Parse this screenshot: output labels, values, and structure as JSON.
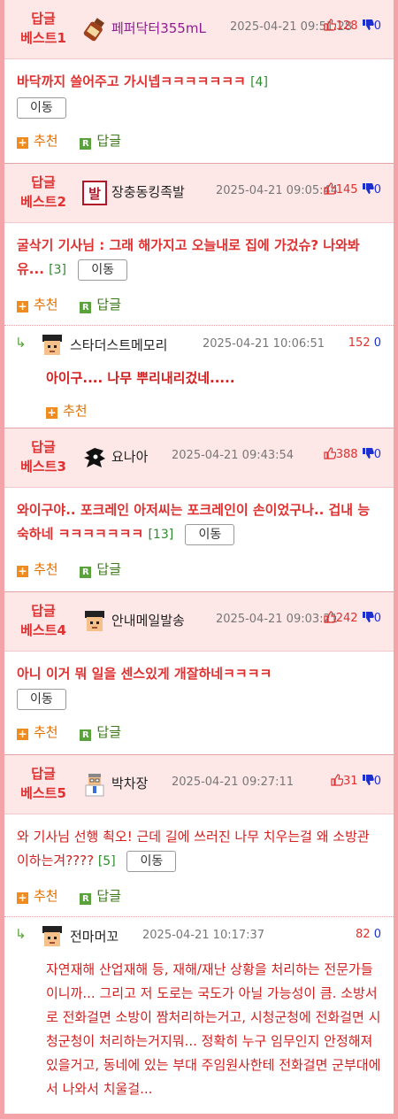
{
  "colors": {
    "accent": "#e03131",
    "frame": "#f4a3a8",
    "header_bg": "#fde7e7",
    "down": "#1e2fd0",
    "count": "#2d8a2d"
  },
  "labels": {
    "move": "이동",
    "recommend": "추천",
    "reply": "답글",
    "reply_badge": "R",
    "recommend_badge": "+"
  },
  "posts": [
    {
      "rank_line1": "답글",
      "rank_line2": "베스트1",
      "nick": "페퍼닥터355mL",
      "date": "2025-04-21 09:51:28",
      "up": "128",
      "down": "0",
      "text": "바닥까지 쓸어주고 가시넵ㅋㅋㅋㅋㅋㅋㅋ",
      "count": "[4]"
    },
    {
      "rank_line1": "답글",
      "rank_line2": "베스트2",
      "nick": "장충동킹족발",
      "date": "2025-04-21 09:05:44",
      "up": "145",
      "down": "0",
      "text": "굴삭기 기사님 : 그래 해가지고 오늘내로 집에 가겄슈? 나와봐유...",
      "count": "[3]"
    },
    {
      "rank_line1": "답글",
      "rank_line2": "베스트3",
      "nick": "요나아",
      "date": "2025-04-21 09:43:54",
      "up": "388",
      "down": "0",
      "text": "와이구야.. 포크레인 아저씨는 포크레인이 손이었구나.. 겁내 능숙하네 ㅋㅋㅋㅋㅋㅋㅋ",
      "count": "[13]"
    },
    {
      "rank_line1": "답글",
      "rank_line2": "베스트4",
      "nick": "안내메일발송",
      "date": "2025-04-21 09:03:21",
      "up": "242",
      "down": "0",
      "text": "아니 이거 뭐 일을 센스있게 개잘하네ㅋㅋㅋㅋ",
      "count": ""
    },
    {
      "rank_line1": "답글",
      "rank_line2": "베스트5",
      "nick": "박차장",
      "date": "2025-04-21 09:27:11",
      "up": "31",
      "down": "0",
      "text": "와 기사님 선행 쵝오! 근데 길에 쓰러진 나무 치우는걸 왜 소방관이하는겨????",
      "count": "[5]"
    }
  ],
  "replies": [
    {
      "nick": "스타더스트메모리",
      "date": "2025-04-21 10:06:51",
      "up": "152",
      "down": "0",
      "text": "아이구.... 나무 뿌리내리겄네....."
    },
    {
      "nick": "전마머꼬",
      "date": "2025-04-21 10:17:37",
      "up": "82",
      "down": "0",
      "text": "자연재해 산업재해 등, 재해/재난 상황을 처리하는 전문가들이니까... 그리고 저 도로는 국도가 아닐 가능성이 큼. 소방서로 전화걸면 소방이 짬처리하는거고, 시청군청에 전화걸면 시청군청이 처리하는거지뭐... 정확히 누구 임무인지 안정해져있을거고, 동네에 있는 부대 주임원사한테 전화걸면 군부대에서 나와서 치울걸..."
    }
  ],
  "icons": [
    "bottle-avatar-icon",
    "bal-badge-avatar-icon",
    "pixel-face-avatar-icon",
    "sonic-avatar-icon",
    "doctor-avatar-icon",
    "reply-arrow-icon",
    "thumbs-up-icon",
    "thumbs-down-icon"
  ]
}
